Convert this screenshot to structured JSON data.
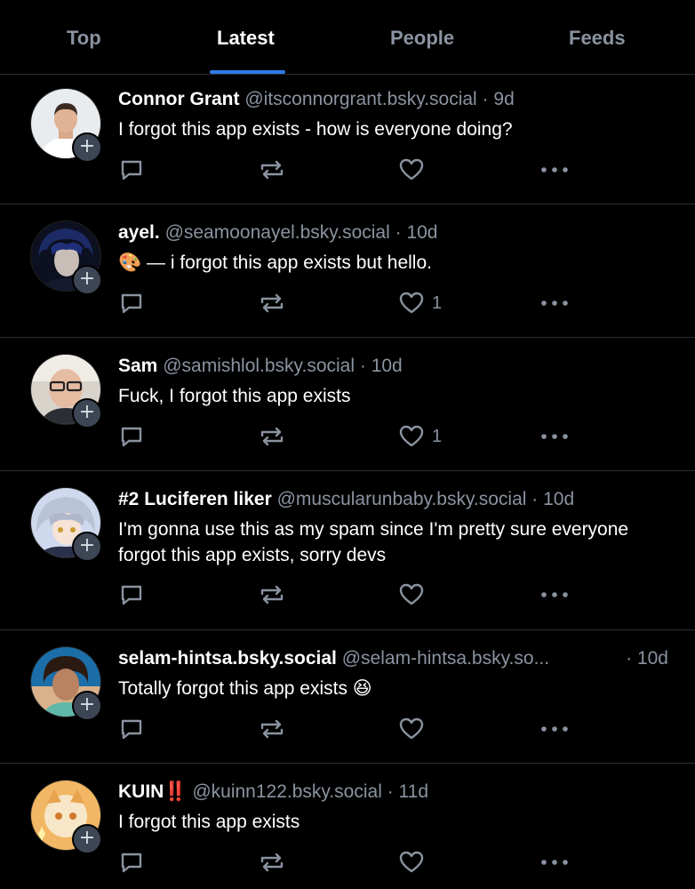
{
  "tabs": [
    {
      "label": "Top"
    },
    {
      "label": "Latest"
    },
    {
      "label": "People"
    },
    {
      "label": "Feeds"
    }
  ],
  "active_tab": "Latest",
  "accent_color": "#2f7be6",
  "posts": [
    {
      "name": "Connor Grant",
      "handle": "@itsconnorgrant.bsky.social",
      "time": "· 9d",
      "text": "I forgot this app exists - how is everyone doing?",
      "like_count": ""
    },
    {
      "name": "ayel.",
      "handle": "@seamoonayel.bsky.social",
      "time": "· 10d",
      "text": "🎨 — i forgot this app exists but hello.",
      "like_count": "1"
    },
    {
      "name": "Sam",
      "handle": "@samishlol.bsky.social",
      "time": "· 10d",
      "text": "Fuck, I forgot this app exists",
      "like_count": "1"
    },
    {
      "name": "#2 Luciferen liker",
      "handle": "@muscularunbaby.bsky.social",
      "time": "· 10d",
      "text": "I'm gonna use this as my spam since I'm pretty sure everyone forgot this app exists, sorry devs",
      "like_count": ""
    },
    {
      "name": "selam-hintsa.bsky.social",
      "handle": "@selam-hintsa.bsky.so...",
      "time": "· 10d",
      "text": "Totally forgot this app exists 😆",
      "like_count": ""
    },
    {
      "name": "KUIN‼️",
      "handle": "@kuinn122.bsky.social",
      "time": "· 11d",
      "text": "I forgot this app exists",
      "like_count": ""
    }
  ],
  "follow_badge": "+"
}
